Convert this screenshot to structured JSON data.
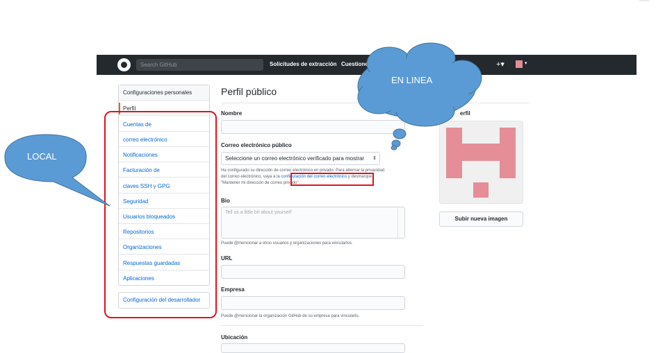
{
  "header": {
    "search_placeholder": "Search GitHub",
    "nav": [
      "Solicitudes de extracción",
      "Cuestione"
    ],
    "plus": "+▾",
    "caret": "▾"
  },
  "sidebar": {
    "heading": "Configuraciones personales",
    "active": "Perfil",
    "items": [
      "Cuentas de",
      "correo electrónico",
      "Notificaciones",
      "Facturación de",
      "claves SSH y GPG",
      "Seguridad",
      "Usuarios bloqueados",
      "Repositorios",
      "Organizaciones",
      "Respuestas guardadas",
      "Aplicaciones"
    ],
    "developer": "Configuración del desarrollador"
  },
  "main": {
    "title": "Perfil público",
    "name_label": "Nombre",
    "email_label": "Correo electrónico público",
    "email_select": "Seleccione un correo electrónico verificado para mostrar",
    "email_note_1": "Ha configurado su dirección de correo electrónico en privado. Para alternar la privacidad",
    "email_note_2a": "del correo electrónico, vaya a la ",
    "email_note_link": "configuración del correo electrónico",
    "email_note_2b": " y desmarque",
    "email_note_3": "\"Mantener mi dirección de correo privado\".",
    "bio_label": "Bio",
    "bio_placeholder": "Tell us a little bit about yourself",
    "bio_note": "Puede @mencionar a otros usuarios y organizaciones para vincularlos.",
    "url_label": "URL",
    "company_label": "Empresa",
    "company_note": "Puede @mencionar la organización GitHub de su empresa para vincularlo.",
    "location_label": "Ubicación"
  },
  "picture": {
    "label": "erfil",
    "upload": "Subir nueva imagen",
    "identicon_color": "#e58e98"
  },
  "annotations": {
    "local": "LOCAL",
    "online": "EN LINEA",
    "callout_color": "#5b9bd5",
    "highlight_color": "#e1101e"
  }
}
